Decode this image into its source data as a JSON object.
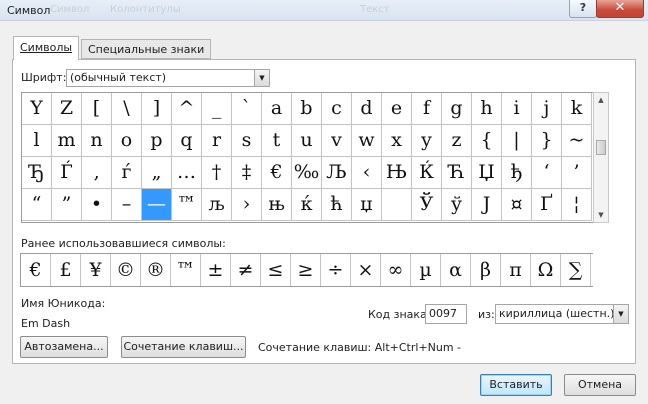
{
  "window": {
    "title": "Символ",
    "help_label": "?",
    "close_label": "✕",
    "ghost_left": "Символ",
    "ghost_mid": "Колонтитулы",
    "ghost_right": "Текст"
  },
  "tabs": [
    {
      "label": "Символы"
    },
    {
      "label": "Специальные знаки"
    }
  ],
  "font": {
    "label": "Шрифт:",
    "value": "(обычный текст)"
  },
  "grid": {
    "rows": [
      [
        "Y",
        "Z",
        "[",
        "\\",
        "]",
        "^",
        "_",
        "`",
        "a",
        "b",
        "c",
        "d",
        "e",
        "f",
        "g",
        "h",
        "i",
        "j",
        "k"
      ],
      [
        "l",
        "m",
        "n",
        "o",
        "p",
        "q",
        "r",
        "s",
        "t",
        "u",
        "v",
        "w",
        "x",
        "y",
        "z",
        "{",
        "|",
        "}",
        "~"
      ],
      [
        "Ђ",
        "Ѓ",
        "‚",
        "ѓ",
        "„",
        "…",
        "†",
        "‡",
        "€",
        "‰",
        "Љ",
        "‹",
        "Њ",
        "Ќ",
        "Ћ",
        "Џ",
        "ђ",
        "‘",
        "’"
      ],
      [
        "“",
        "”",
        "•",
        "–",
        "—",
        "™",
        "љ",
        "›",
        "њ",
        "ќ",
        "ћ",
        "џ",
        " ",
        "Ў",
        "ў",
        "Ј",
        "¤",
        "Ґ",
        "¦"
      ]
    ],
    "selected_row": 3,
    "selected_col": 4
  },
  "recent": {
    "label": "Ранее использовавшиеся символы:",
    "symbols": [
      "€",
      "£",
      "¥",
      "©",
      "®",
      "™",
      "±",
      "≠",
      "≤",
      "≥",
      "÷",
      "×",
      "∞",
      "µ",
      "α",
      "β",
      "π",
      "Ω",
      "∑"
    ]
  },
  "unicode": {
    "name_label": "Имя Юникода:",
    "name_value": "Em Dash"
  },
  "code": {
    "label": "Код знака:",
    "value": "0097",
    "from_label": "из:",
    "from_value": "кириллица (шестн.)"
  },
  "buttons": {
    "autocorrect": "Автозамена...",
    "shortcut_key": "Сочетание клавиш...",
    "shortcut_text": "Сочетание клавиш: Alt+Ctrl+Num -",
    "insert": "Вставить",
    "cancel": "Отмена"
  },
  "icons": {
    "dropdown": "chevron-down-icon",
    "scroll_up": "scroll-up-icon",
    "scroll_down": "scroll-down-icon"
  }
}
